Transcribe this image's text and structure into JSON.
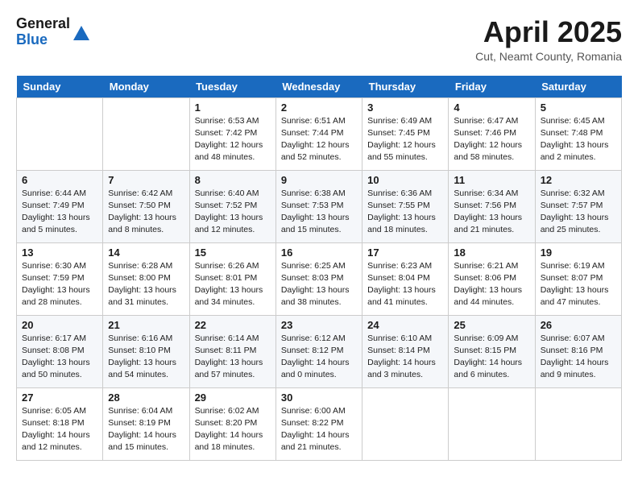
{
  "header": {
    "logo_general": "General",
    "logo_blue": "Blue",
    "month": "April 2025",
    "location": "Cut, Neamt County, Romania"
  },
  "days_of_week": [
    "Sunday",
    "Monday",
    "Tuesday",
    "Wednesday",
    "Thursday",
    "Friday",
    "Saturday"
  ],
  "weeks": [
    [
      {
        "day": "",
        "info": ""
      },
      {
        "day": "",
        "info": ""
      },
      {
        "day": "1",
        "info": "Sunrise: 6:53 AM\nSunset: 7:42 PM\nDaylight: 12 hours\nand 48 minutes."
      },
      {
        "day": "2",
        "info": "Sunrise: 6:51 AM\nSunset: 7:44 PM\nDaylight: 12 hours\nand 52 minutes."
      },
      {
        "day": "3",
        "info": "Sunrise: 6:49 AM\nSunset: 7:45 PM\nDaylight: 12 hours\nand 55 minutes."
      },
      {
        "day": "4",
        "info": "Sunrise: 6:47 AM\nSunset: 7:46 PM\nDaylight: 12 hours\nand 58 minutes."
      },
      {
        "day": "5",
        "info": "Sunrise: 6:45 AM\nSunset: 7:48 PM\nDaylight: 13 hours\nand 2 minutes."
      }
    ],
    [
      {
        "day": "6",
        "info": "Sunrise: 6:44 AM\nSunset: 7:49 PM\nDaylight: 13 hours\nand 5 minutes."
      },
      {
        "day": "7",
        "info": "Sunrise: 6:42 AM\nSunset: 7:50 PM\nDaylight: 13 hours\nand 8 minutes."
      },
      {
        "day": "8",
        "info": "Sunrise: 6:40 AM\nSunset: 7:52 PM\nDaylight: 13 hours\nand 12 minutes."
      },
      {
        "day": "9",
        "info": "Sunrise: 6:38 AM\nSunset: 7:53 PM\nDaylight: 13 hours\nand 15 minutes."
      },
      {
        "day": "10",
        "info": "Sunrise: 6:36 AM\nSunset: 7:55 PM\nDaylight: 13 hours\nand 18 minutes."
      },
      {
        "day": "11",
        "info": "Sunrise: 6:34 AM\nSunset: 7:56 PM\nDaylight: 13 hours\nand 21 minutes."
      },
      {
        "day": "12",
        "info": "Sunrise: 6:32 AM\nSunset: 7:57 PM\nDaylight: 13 hours\nand 25 minutes."
      }
    ],
    [
      {
        "day": "13",
        "info": "Sunrise: 6:30 AM\nSunset: 7:59 PM\nDaylight: 13 hours\nand 28 minutes."
      },
      {
        "day": "14",
        "info": "Sunrise: 6:28 AM\nSunset: 8:00 PM\nDaylight: 13 hours\nand 31 minutes."
      },
      {
        "day": "15",
        "info": "Sunrise: 6:26 AM\nSunset: 8:01 PM\nDaylight: 13 hours\nand 34 minutes."
      },
      {
        "day": "16",
        "info": "Sunrise: 6:25 AM\nSunset: 8:03 PM\nDaylight: 13 hours\nand 38 minutes."
      },
      {
        "day": "17",
        "info": "Sunrise: 6:23 AM\nSunset: 8:04 PM\nDaylight: 13 hours\nand 41 minutes."
      },
      {
        "day": "18",
        "info": "Sunrise: 6:21 AM\nSunset: 8:06 PM\nDaylight: 13 hours\nand 44 minutes."
      },
      {
        "day": "19",
        "info": "Sunrise: 6:19 AM\nSunset: 8:07 PM\nDaylight: 13 hours\nand 47 minutes."
      }
    ],
    [
      {
        "day": "20",
        "info": "Sunrise: 6:17 AM\nSunset: 8:08 PM\nDaylight: 13 hours\nand 50 minutes."
      },
      {
        "day": "21",
        "info": "Sunrise: 6:16 AM\nSunset: 8:10 PM\nDaylight: 13 hours\nand 54 minutes."
      },
      {
        "day": "22",
        "info": "Sunrise: 6:14 AM\nSunset: 8:11 PM\nDaylight: 13 hours\nand 57 minutes."
      },
      {
        "day": "23",
        "info": "Sunrise: 6:12 AM\nSunset: 8:12 PM\nDaylight: 14 hours\nand 0 minutes."
      },
      {
        "day": "24",
        "info": "Sunrise: 6:10 AM\nSunset: 8:14 PM\nDaylight: 14 hours\nand 3 minutes."
      },
      {
        "day": "25",
        "info": "Sunrise: 6:09 AM\nSunset: 8:15 PM\nDaylight: 14 hours\nand 6 minutes."
      },
      {
        "day": "26",
        "info": "Sunrise: 6:07 AM\nSunset: 8:16 PM\nDaylight: 14 hours\nand 9 minutes."
      }
    ],
    [
      {
        "day": "27",
        "info": "Sunrise: 6:05 AM\nSunset: 8:18 PM\nDaylight: 14 hours\nand 12 minutes."
      },
      {
        "day": "28",
        "info": "Sunrise: 6:04 AM\nSunset: 8:19 PM\nDaylight: 14 hours\nand 15 minutes."
      },
      {
        "day": "29",
        "info": "Sunrise: 6:02 AM\nSunset: 8:20 PM\nDaylight: 14 hours\nand 18 minutes."
      },
      {
        "day": "30",
        "info": "Sunrise: 6:00 AM\nSunset: 8:22 PM\nDaylight: 14 hours\nand 21 minutes."
      },
      {
        "day": "",
        "info": ""
      },
      {
        "day": "",
        "info": ""
      },
      {
        "day": "",
        "info": ""
      }
    ]
  ]
}
